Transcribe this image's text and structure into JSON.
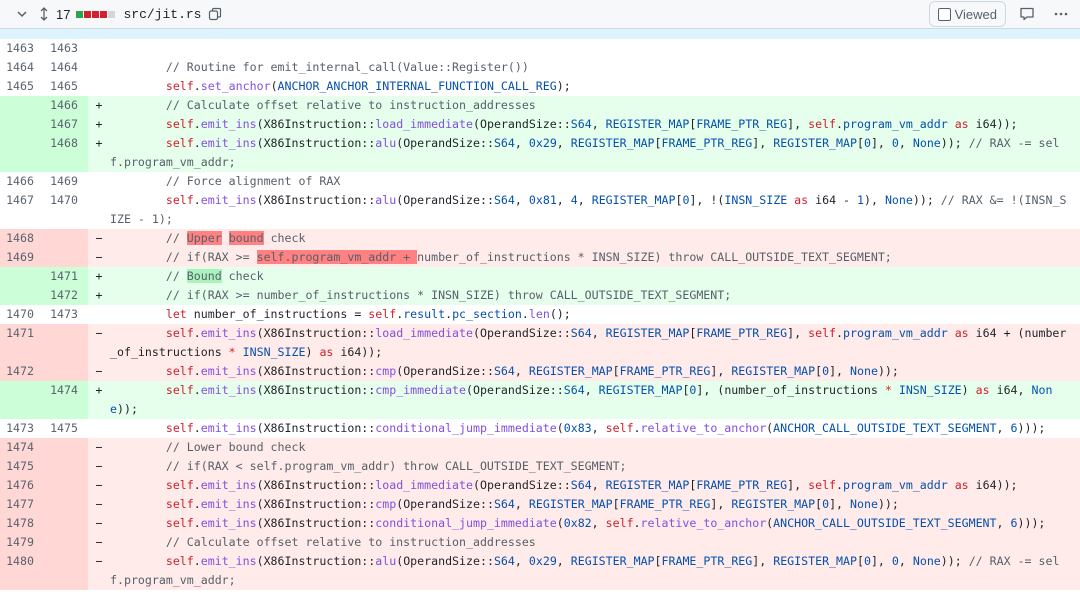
{
  "header": {
    "changes_count": "17",
    "file_path": "src/jit.rs",
    "viewed_label": "Viewed",
    "colors": {
      "added": "#2da44e",
      "deleted": "#cf222e",
      "neutral": "#d0d7de"
    },
    "icons": {
      "collapse": "chevron-down-icon",
      "expand": "unfold-icon",
      "copy": "copy-icon",
      "comment": "comment-icon",
      "more": "kebab-horizontal-icon"
    }
  },
  "lines": [
    {
      "type": "ctx",
      "old": "1463",
      "new": "1463",
      "marker": "",
      "tokens": []
    },
    {
      "type": "ctx",
      "old": "1464",
      "new": "1464",
      "marker": "",
      "tokens": [
        {
          "t": "        // Routine for emit_internal_call(Value::Register())",
          "c": "cm"
        }
      ]
    },
    {
      "type": "ctx",
      "old": "1465",
      "new": "1465",
      "marker": "",
      "tokens": [
        {
          "t": "        self",
          "c": "k"
        },
        {
          "t": "."
        },
        {
          "t": "set_anchor",
          "c": "f"
        },
        {
          "t": "("
        },
        {
          "t": "ANCHOR_ANCHOR_INTERNAL_FUNCTION_CALL_REG",
          "c": "c"
        },
        {
          "t": ");"
        }
      ]
    },
    {
      "type": "add",
      "old": "",
      "new": "1466",
      "marker": "+",
      "tokens": [
        {
          "t": "        // Calculate offset relative to instruction_addresses",
          "c": "cm"
        }
      ]
    },
    {
      "type": "add",
      "old": "",
      "new": "1467",
      "marker": "+",
      "tokens": [
        {
          "t": "        self",
          "c": "k"
        },
        {
          "t": "."
        },
        {
          "t": "emit_ins",
          "c": "f"
        },
        {
          "t": "(X86Instruction::"
        },
        {
          "t": "load_immediate",
          "c": "f"
        },
        {
          "t": "(OperandSize::"
        },
        {
          "t": "S64",
          "c": "c"
        },
        {
          "t": ", "
        },
        {
          "t": "REGISTER_MAP",
          "c": "c"
        },
        {
          "t": "["
        },
        {
          "t": "FRAME_PTR_REG",
          "c": "c"
        },
        {
          "t": "], "
        },
        {
          "t": "self",
          "c": "k"
        },
        {
          "t": "."
        },
        {
          "t": "program_vm_addr",
          "c": "c"
        },
        {
          "t": " "
        },
        {
          "t": "as",
          "c": "k"
        },
        {
          "t": " i64));"
        }
      ]
    },
    {
      "type": "add",
      "old": "",
      "new": "1468",
      "marker": "+",
      "tokens": [
        {
          "t": "        self",
          "c": "k"
        },
        {
          "t": "."
        },
        {
          "t": "emit_ins",
          "c": "f"
        },
        {
          "t": "(X86Instruction::"
        },
        {
          "t": "alu",
          "c": "f"
        },
        {
          "t": "(OperandSize::"
        },
        {
          "t": "S64",
          "c": "c"
        },
        {
          "t": ", "
        },
        {
          "t": "0x29",
          "c": "c"
        },
        {
          "t": ", "
        },
        {
          "t": "REGISTER_MAP",
          "c": "c"
        },
        {
          "t": "["
        },
        {
          "t": "FRAME_PTR_REG",
          "c": "c"
        },
        {
          "t": "], "
        },
        {
          "t": "REGISTER_MAP",
          "c": "c"
        },
        {
          "t": "["
        },
        {
          "t": "0",
          "c": "c"
        },
        {
          "t": "], "
        },
        {
          "t": "0",
          "c": "c"
        },
        {
          "t": ", "
        },
        {
          "t": "None",
          "c": "c"
        },
        {
          "t": ")); "
        },
        {
          "t": "// RAX -= self.program_vm_addr;",
          "c": "cm"
        }
      ]
    },
    {
      "type": "ctx",
      "old": "1466",
      "new": "1469",
      "marker": "",
      "tokens": [
        {
          "t": "        // Force alignment of RAX",
          "c": "cm"
        }
      ]
    },
    {
      "type": "ctx",
      "old": "1467",
      "new": "1470",
      "marker": "",
      "tokens": [
        {
          "t": "        self",
          "c": "k"
        },
        {
          "t": "."
        },
        {
          "t": "emit_ins",
          "c": "f"
        },
        {
          "t": "(X86Instruction::"
        },
        {
          "t": "alu",
          "c": "f"
        },
        {
          "t": "(OperandSize::"
        },
        {
          "t": "S64",
          "c": "c"
        },
        {
          "t": ", "
        },
        {
          "t": "0x81",
          "c": "c"
        },
        {
          "t": ", "
        },
        {
          "t": "4",
          "c": "c"
        },
        {
          "t": ", "
        },
        {
          "t": "REGISTER_MAP",
          "c": "c"
        },
        {
          "t": "["
        },
        {
          "t": "0",
          "c": "c"
        },
        {
          "t": "], !("
        },
        {
          "t": "INSN_SIZE",
          "c": "c"
        },
        {
          "t": " "
        },
        {
          "t": "as",
          "c": "k"
        },
        {
          "t": " i64 - "
        },
        {
          "t": "1",
          "c": "c"
        },
        {
          "t": "), "
        },
        {
          "t": "None",
          "c": "c"
        },
        {
          "t": ")); "
        },
        {
          "t": "// RAX &= !(INSN_SIZE - 1);",
          "c": "cm"
        }
      ]
    },
    {
      "type": "del",
      "old": "1468",
      "new": "",
      "marker": "−",
      "tokens": [
        {
          "t": "        // ",
          "c": "cm"
        },
        {
          "t": "Upper",
          "c": "cm",
          "hl": true
        },
        {
          "t": " ",
          "c": "cm"
        },
        {
          "t": "bound",
          "c": "cm",
          "hl": true
        },
        {
          "t": " check",
          "c": "cm"
        }
      ]
    },
    {
      "type": "del",
      "old": "1469",
      "new": "",
      "marker": "−",
      "tokens": [
        {
          "t": "        // if(RAX >= ",
          "c": "cm"
        },
        {
          "t": "self.program_vm_addr + ",
          "c": "cm",
          "hl": true
        },
        {
          "t": "number_of_instructions * INSN_SIZE) throw CALL_OUTSIDE_TEXT_SEGMENT;",
          "c": "cm"
        }
      ]
    },
    {
      "type": "add",
      "old": "",
      "new": "1471",
      "marker": "+",
      "tokens": [
        {
          "t": "        // ",
          "c": "cm"
        },
        {
          "t": "Bound",
          "c": "cm",
          "hl": true
        },
        {
          "t": " check",
          "c": "cm"
        }
      ]
    },
    {
      "type": "add",
      "old": "",
      "new": "1472",
      "marker": "+",
      "tokens": [
        {
          "t": "        // if(RAX >= number_of_instructions * INSN_SIZE) throw CALL_OUTSIDE_TEXT_SEGMENT;",
          "c": "cm"
        }
      ]
    },
    {
      "type": "ctx",
      "old": "1470",
      "new": "1473",
      "marker": "",
      "tokens": [
        {
          "t": "        "
        },
        {
          "t": "let",
          "c": "k"
        },
        {
          "t": " number_of_instructions = "
        },
        {
          "t": "self",
          "c": "k"
        },
        {
          "t": "."
        },
        {
          "t": "result",
          "c": "c"
        },
        {
          "t": "."
        },
        {
          "t": "pc_section",
          "c": "c"
        },
        {
          "t": "."
        },
        {
          "t": "len",
          "c": "f"
        },
        {
          "t": "();"
        }
      ]
    },
    {
      "type": "del",
      "old": "1471",
      "new": "",
      "marker": "−",
      "tokens": [
        {
          "t": "        self",
          "c": "k"
        },
        {
          "t": "."
        },
        {
          "t": "emit_ins",
          "c": "f"
        },
        {
          "t": "(X86Instruction::"
        },
        {
          "t": "load_immediate",
          "c": "f"
        },
        {
          "t": "(OperandSize::"
        },
        {
          "t": "S64",
          "c": "c"
        },
        {
          "t": ", "
        },
        {
          "t": "REGISTER_MAP",
          "c": "c"
        },
        {
          "t": "["
        },
        {
          "t": "FRAME_PTR_REG",
          "c": "c"
        },
        {
          "t": "], "
        },
        {
          "t": "self",
          "c": "k"
        },
        {
          "t": "."
        },
        {
          "t": "program_vm_addr",
          "c": "c"
        },
        {
          "t": " "
        },
        {
          "t": "as",
          "c": "k"
        },
        {
          "t": " i64 + (number_of_instructions "
        },
        {
          "t": "*",
          "c": "k"
        },
        {
          "t": " "
        },
        {
          "t": "INSN_SIZE",
          "c": "c"
        },
        {
          "t": ") "
        },
        {
          "t": "as",
          "c": "k"
        },
        {
          "t": " i64));"
        }
      ]
    },
    {
      "type": "del",
      "old": "1472",
      "new": "",
      "marker": "−",
      "tokens": [
        {
          "t": "        self",
          "c": "k"
        },
        {
          "t": "."
        },
        {
          "t": "emit_ins",
          "c": "f"
        },
        {
          "t": "(X86Instruction::"
        },
        {
          "t": "cmp",
          "c": "f"
        },
        {
          "t": "(OperandSize::"
        },
        {
          "t": "S64",
          "c": "c"
        },
        {
          "t": ", "
        },
        {
          "t": "REGISTER_MAP",
          "c": "c"
        },
        {
          "t": "["
        },
        {
          "t": "FRAME_PTR_REG",
          "c": "c"
        },
        {
          "t": "], "
        },
        {
          "t": "REGISTER_MAP",
          "c": "c"
        },
        {
          "t": "["
        },
        {
          "t": "0",
          "c": "c"
        },
        {
          "t": "], "
        },
        {
          "t": "None",
          "c": "c"
        },
        {
          "t": "));"
        }
      ]
    },
    {
      "type": "add",
      "old": "",
      "new": "1474",
      "marker": "+",
      "tokens": [
        {
          "t": "        self",
          "c": "k"
        },
        {
          "t": "."
        },
        {
          "t": "emit_ins",
          "c": "f"
        },
        {
          "t": "(X86Instruction::"
        },
        {
          "t": "cmp_immediate",
          "c": "f"
        },
        {
          "t": "(OperandSize::"
        },
        {
          "t": "S64",
          "c": "c"
        },
        {
          "t": ", "
        },
        {
          "t": "REGISTER_MAP",
          "c": "c"
        },
        {
          "t": "["
        },
        {
          "t": "0",
          "c": "c"
        },
        {
          "t": "], (number_of_instructions "
        },
        {
          "t": "*",
          "c": "k"
        },
        {
          "t": " "
        },
        {
          "t": "INSN_SIZE",
          "c": "c"
        },
        {
          "t": ") "
        },
        {
          "t": "as",
          "c": "k"
        },
        {
          "t": " i64, "
        },
        {
          "t": "None",
          "c": "c"
        },
        {
          "t": "));"
        }
      ]
    },
    {
      "type": "ctx",
      "old": "1473",
      "new": "1475",
      "marker": "",
      "tokens": [
        {
          "t": "        self",
          "c": "k"
        },
        {
          "t": "."
        },
        {
          "t": "emit_ins",
          "c": "f"
        },
        {
          "t": "(X86Instruction::"
        },
        {
          "t": "conditional_jump_immediate",
          "c": "f"
        },
        {
          "t": "("
        },
        {
          "t": "0x83",
          "c": "c"
        },
        {
          "t": ", "
        },
        {
          "t": "self",
          "c": "k"
        },
        {
          "t": "."
        },
        {
          "t": "relative_to_anchor",
          "c": "f"
        },
        {
          "t": "("
        },
        {
          "t": "ANCHOR_CALL_OUTSIDE_TEXT_SEGMENT",
          "c": "c"
        },
        {
          "t": ", "
        },
        {
          "t": "6",
          "c": "c"
        },
        {
          "t": ")));"
        }
      ]
    },
    {
      "type": "del",
      "old": "1474",
      "new": "",
      "marker": "−",
      "tokens": [
        {
          "t": "        // Lower bound check",
          "c": "cm"
        }
      ]
    },
    {
      "type": "del",
      "old": "1475",
      "new": "",
      "marker": "−",
      "tokens": [
        {
          "t": "        // if(RAX < self.program_vm_addr) throw CALL_OUTSIDE_TEXT_SEGMENT;",
          "c": "cm"
        }
      ]
    },
    {
      "type": "del",
      "old": "1476",
      "new": "",
      "marker": "−",
      "tokens": [
        {
          "t": "        self",
          "c": "k"
        },
        {
          "t": "."
        },
        {
          "t": "emit_ins",
          "c": "f"
        },
        {
          "t": "(X86Instruction::"
        },
        {
          "t": "load_immediate",
          "c": "f"
        },
        {
          "t": "(OperandSize::"
        },
        {
          "t": "S64",
          "c": "c"
        },
        {
          "t": ", "
        },
        {
          "t": "REGISTER_MAP",
          "c": "c"
        },
        {
          "t": "["
        },
        {
          "t": "FRAME_PTR_REG",
          "c": "c"
        },
        {
          "t": "], "
        },
        {
          "t": "self",
          "c": "k"
        },
        {
          "t": "."
        },
        {
          "t": "program_vm_addr",
          "c": "c"
        },
        {
          "t": " "
        },
        {
          "t": "as",
          "c": "k"
        },
        {
          "t": " i64));"
        }
      ]
    },
    {
      "type": "del",
      "old": "1477",
      "new": "",
      "marker": "−",
      "tokens": [
        {
          "t": "        self",
          "c": "k"
        },
        {
          "t": "."
        },
        {
          "t": "emit_ins",
          "c": "f"
        },
        {
          "t": "(X86Instruction::"
        },
        {
          "t": "cmp",
          "c": "f"
        },
        {
          "t": "(OperandSize::"
        },
        {
          "t": "S64",
          "c": "c"
        },
        {
          "t": ", "
        },
        {
          "t": "REGISTER_MAP",
          "c": "c"
        },
        {
          "t": "["
        },
        {
          "t": "FRAME_PTR_REG",
          "c": "c"
        },
        {
          "t": "], "
        },
        {
          "t": "REGISTER_MAP",
          "c": "c"
        },
        {
          "t": "["
        },
        {
          "t": "0",
          "c": "c"
        },
        {
          "t": "], "
        },
        {
          "t": "None",
          "c": "c"
        },
        {
          "t": "));"
        }
      ]
    },
    {
      "type": "del",
      "old": "1478",
      "new": "",
      "marker": "−",
      "tokens": [
        {
          "t": "        self",
          "c": "k"
        },
        {
          "t": "."
        },
        {
          "t": "emit_ins",
          "c": "f"
        },
        {
          "t": "(X86Instruction::"
        },
        {
          "t": "conditional_jump_immediate",
          "c": "f"
        },
        {
          "t": "("
        },
        {
          "t": "0x82",
          "c": "c"
        },
        {
          "t": ", "
        },
        {
          "t": "self",
          "c": "k"
        },
        {
          "t": "."
        },
        {
          "t": "relative_to_anchor",
          "c": "f"
        },
        {
          "t": "("
        },
        {
          "t": "ANCHOR_CALL_OUTSIDE_TEXT_SEGMENT",
          "c": "c"
        },
        {
          "t": ", "
        },
        {
          "t": "6",
          "c": "c"
        },
        {
          "t": ")));"
        }
      ]
    },
    {
      "type": "del",
      "old": "1479",
      "new": "",
      "marker": "−",
      "tokens": [
        {
          "t": "        // Calculate offset relative to instruction_addresses",
          "c": "cm"
        }
      ]
    },
    {
      "type": "del",
      "old": "1480",
      "new": "",
      "marker": "−",
      "tokens": [
        {
          "t": "        self",
          "c": "k"
        },
        {
          "t": "."
        },
        {
          "t": "emit_ins",
          "c": "f"
        },
        {
          "t": "(X86Instruction::"
        },
        {
          "t": "alu",
          "c": "f"
        },
        {
          "t": "(OperandSize::"
        },
        {
          "t": "S64",
          "c": "c"
        },
        {
          "t": ", "
        },
        {
          "t": "0x29",
          "c": "c"
        },
        {
          "t": ", "
        },
        {
          "t": "REGISTER_MAP",
          "c": "c"
        },
        {
          "t": "["
        },
        {
          "t": "FRAME_PTR_REG",
          "c": "c"
        },
        {
          "t": "], "
        },
        {
          "t": "REGISTER_MAP",
          "c": "c"
        },
        {
          "t": "["
        },
        {
          "t": "0",
          "c": "c"
        },
        {
          "t": "], "
        },
        {
          "t": "0",
          "c": "c"
        },
        {
          "t": ", "
        },
        {
          "t": "None",
          "c": "c"
        },
        {
          "t": ")); "
        },
        {
          "t": "// RAX -= self.program_vm_addr;",
          "c": "cm"
        }
      ]
    }
  ]
}
